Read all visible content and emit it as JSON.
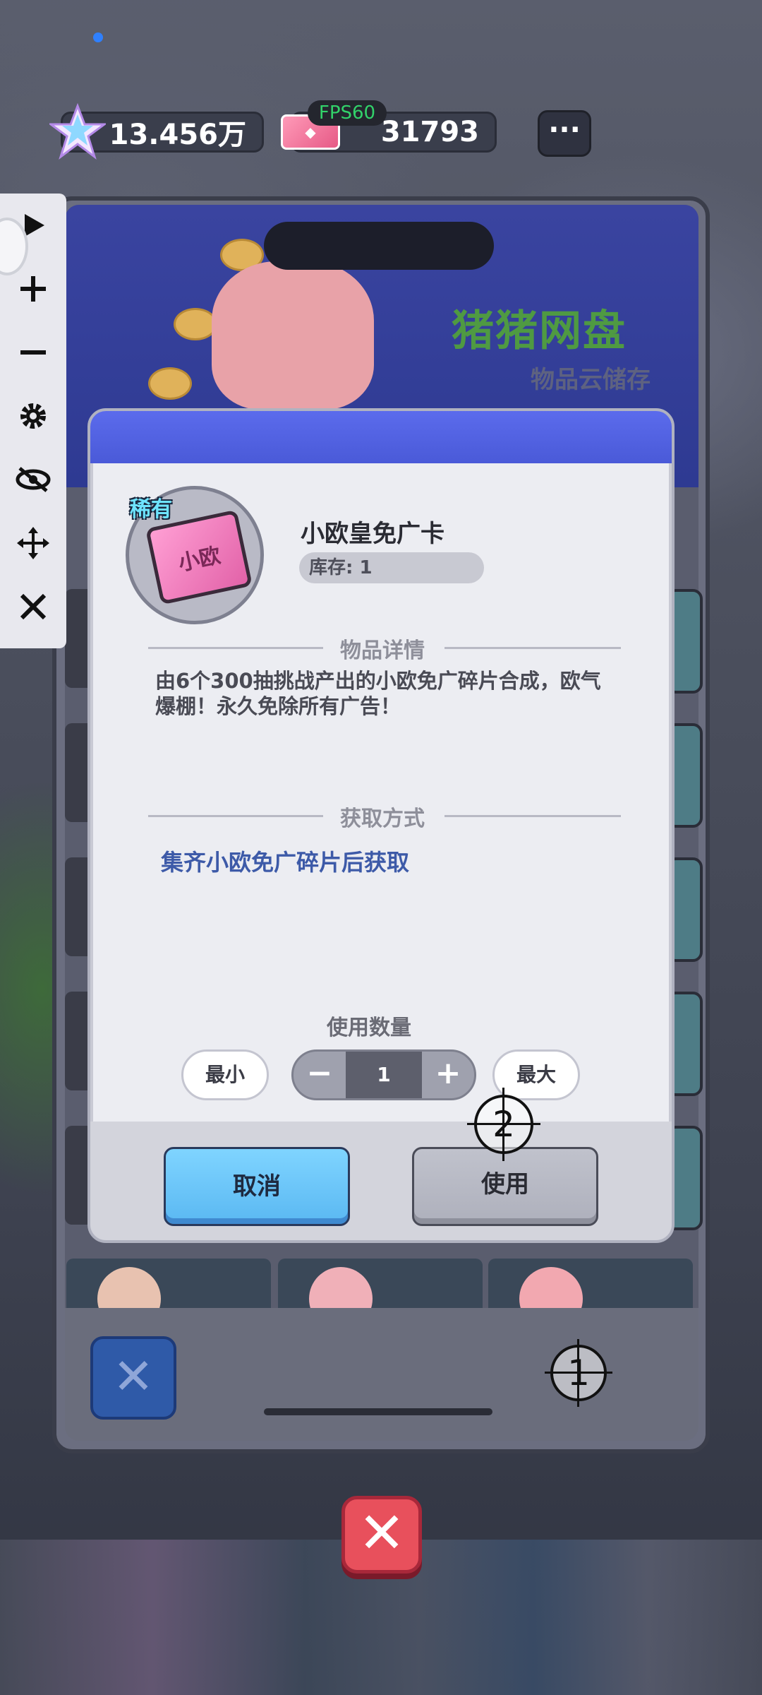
{
  "status": {
    "fps": "FPS60"
  },
  "resources": {
    "stars": "13.456万",
    "tickets": "31793",
    "more_label": "···"
  },
  "toolbar": {
    "icons": [
      "play-icon",
      "plus-icon",
      "minus-icon",
      "gear-icon",
      "eye-off-icon",
      "move-icon",
      "close-icon"
    ]
  },
  "panel": {
    "banner_title": "猪猪网盘",
    "banner_subtitle": "物品云储存",
    "close_label": "✕"
  },
  "dialog": {
    "rarity": "稀有",
    "item_image_text": "小欧",
    "item_name": "小欧皇免广卡",
    "stock": "库存: 1",
    "details_title": "物品详情",
    "description": "由6个300抽挑战产出的小欧免广碎片合成，欧气爆棚！永久免除所有广告！",
    "acquire_title": "获取方式",
    "acquire_text": "集齐小欧免广碎片后获取",
    "quantity_title": "使用数量",
    "min_label": "最小",
    "max_label": "最大",
    "quantity_value": "1",
    "minus_label": "−",
    "plus_label": "+",
    "cancel_label": "取消",
    "use_label": "使用"
  },
  "overlay": {
    "marker_1": "1",
    "marker_2": "2"
  },
  "colors": {
    "dialog_header": "#5b6bec",
    "cancel_button": "#7fd4ff",
    "acquire_text": "#3d5aa8",
    "rarity_text": "#6ee4ff",
    "fps_text": "#32d26a",
    "close_button": "#e8505c"
  }
}
